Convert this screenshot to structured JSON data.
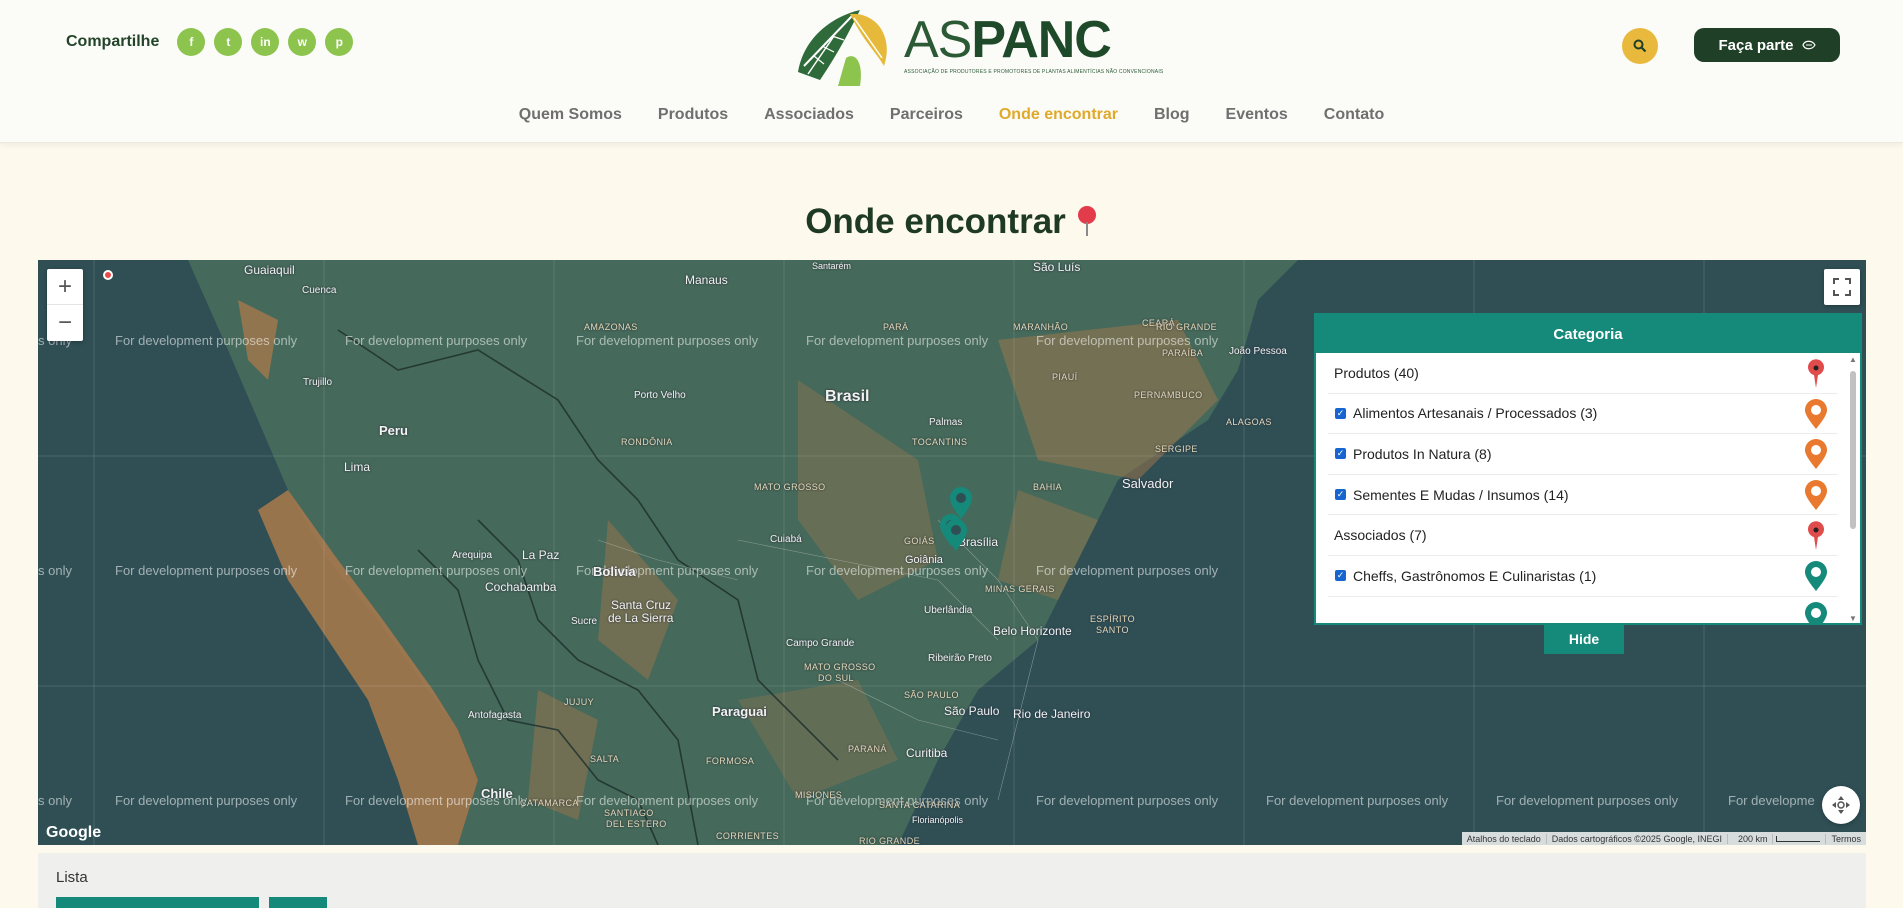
{
  "header": {
    "share_label": "Compartilhe",
    "social": [
      {
        "icon": "facebook-icon",
        "glyph": "f"
      },
      {
        "icon": "twitter-icon",
        "glyph": "t"
      },
      {
        "icon": "linkedin-icon",
        "glyph": "in"
      },
      {
        "icon": "whatsapp-icon",
        "glyph": "w"
      },
      {
        "icon": "pinterest-icon",
        "glyph": "p"
      }
    ],
    "logo": {
      "light": "AS",
      "bold": "PANC",
      "tagline": "ASSOCIAÇÃO DE PRODUTORES E PROMOTORES DE PLANTAS ALIMENTÍCIAS NÃO CONVENCIONAIS"
    },
    "search_icon": "search-icon",
    "cta_label": "Faça parte"
  },
  "nav": {
    "items": [
      "Quem Somos",
      "Produtos",
      "Associados",
      "Parceiros",
      "Onde encontrar",
      "Blog",
      "Eventos",
      "Contato"
    ],
    "active": "Onde encontrar"
  },
  "page": {
    "title": "Onde encontrar"
  },
  "map": {
    "watermark": "For development purposes only",
    "watermark_fragment_left": "s only",
    "watermark_fragment_right": "For developme",
    "zoom_in": "+",
    "zoom_out": "−",
    "google_logo": "Google",
    "attribution": {
      "keyboard": "Atalhos do teclado",
      "data": "Dados cartográficos ©2025 Google, INEGI",
      "scale": "200 km",
      "terms": "Termos"
    },
    "labels": {
      "guaiaquil": "Guaiaquil",
      "cuenca": "Cuenca",
      "santarem": "Santarém",
      "manaus": "Manaus",
      "sao_luis": "São Luís",
      "amazonas": "AMAZONAS",
      "para": "PARÁ",
      "maranhao": "MARANHÃO",
      "ceara": "CEARÁ",
      "rio_grande": "RIO GRANDE",
      "paraiba": "PARAÍBA",
      "joao_pessoa": "João Pessoa",
      "trujillo": "Trujillo",
      "porto_velho": "Porto Velho",
      "brasil": "Brasil",
      "piaui": "PIAUÍ",
      "pernambuco": "PERNAMBUCO",
      "peru": "Peru",
      "palmas": "Palmas",
      "alagoas": "ALAGOAS",
      "lima": "Lima",
      "rondonia": "RONDÔNIA",
      "tocantins": "TOCANTINS",
      "sergipe": "SERGIPE",
      "mato_grosso": "MATO GROSSO",
      "bahia": "BAHIA",
      "salvador": "Salvador",
      "cuiaba": "Cuiabá",
      "goias": "GOIÁS",
      "brasilia": "Brasília",
      "goiania": "Goiânia",
      "arequipa": "Arequipa",
      "la_paz": "La Paz",
      "bolivia": "Bolivia",
      "cochabamba": "Cochabamba",
      "minas_gerais": "MINAS GERAIS",
      "santa_cruz": "Santa Cruz",
      "de_la_sierra": "de La Sierra",
      "sucre": "Sucre",
      "uberlandia": "Uberlândia",
      "belo_horizonte": "Belo Horizonte",
      "espirito": "ESPÍRITO",
      "santo": "SANTO",
      "campo_grande": "Campo Grande",
      "ribeirao_preto": "Ribeirão Preto",
      "mato_grosso_do_sul_1": "MATO GROSSO",
      "mato_grosso_do_sul_2": "DO SUL",
      "jujuy": "JUJUY",
      "sao_paulo_state": "SÃO PAULO",
      "paraguai": "Paraguai",
      "sao_paulo": "São Paulo",
      "rio_de_janeiro": "Rio de Janeiro",
      "antofagasta": "Antofagasta",
      "salta": "SALTA",
      "formosa": "FORMOSA",
      "parana": "PARANÁ",
      "curitiba": "Curitiba",
      "chile": "Chile",
      "catamarca": "CATAMARCA",
      "misiones": "MISIONES",
      "santa_catarina": "SANTA CATARINA",
      "florianopolis": "Florianópolis",
      "santiago": "SANTIAGO",
      "del_estero": "DEL ESTERO",
      "corrientes": "CORRIENTES",
      "rio_grande_s": "RIO GRANDE"
    }
  },
  "categories": {
    "header": "Categoria",
    "rows": [
      {
        "label": "Produtos (40)",
        "group": true,
        "checked": false,
        "marker_color": "#e04b4b"
      },
      {
        "label": "Alimentos Artesanais / Processados (3)",
        "group": false,
        "checked": true,
        "marker_color": "#e8792e"
      },
      {
        "label": "Produtos In Natura (8)",
        "group": false,
        "checked": true,
        "marker_color": "#e8792e"
      },
      {
        "label": "Sementes E Mudas / Insumos (14)",
        "group": false,
        "checked": true,
        "marker_color": "#e8792e"
      },
      {
        "label": "Associados (7)",
        "group": true,
        "checked": false,
        "marker_color": "#e04b4b"
      },
      {
        "label": "Cheffs, Gastrônomos E Culinaristas (1)",
        "group": false,
        "checked": true,
        "marker_color": "#15897a"
      },
      {
        "label": "",
        "group": false,
        "checked": false,
        "marker_color": "#15897a"
      }
    ],
    "hide_label": "Hide"
  },
  "list": {
    "label": "Lista"
  }
}
